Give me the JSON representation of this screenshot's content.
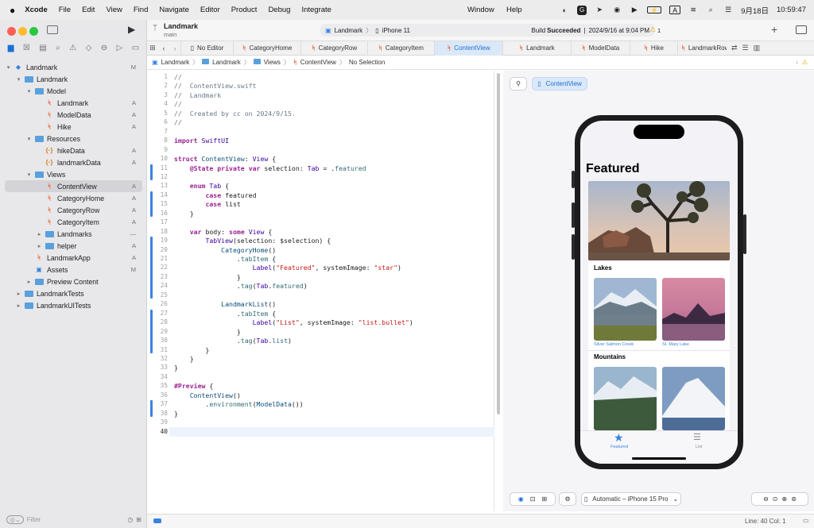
{
  "menubar": {
    "app": "Xcode",
    "items": [
      "File",
      "Edit",
      "View",
      "Find",
      "Navigate",
      "Editor",
      "Product",
      "Debug",
      "Integrate"
    ],
    "right_items": [
      "Window",
      "Help"
    ],
    "date": "9月18日",
    "time": "10:59:47",
    "input_indicator": "A"
  },
  "sidebar": {
    "tree": [
      {
        "label": "Landmark",
        "indent": 0,
        "icon": "project-icon",
        "chev": "▾",
        "badge": "M"
      },
      {
        "label": "Landmark",
        "indent": 1,
        "icon": "folder-icon",
        "chev": "▾",
        "badge": ""
      },
      {
        "label": "Model",
        "indent": 2,
        "icon": "folder-icon",
        "chev": "▾",
        "badge": ""
      },
      {
        "label": "Landmark",
        "indent": 3,
        "icon": "swift-icon",
        "chev": "",
        "badge": "A"
      },
      {
        "label": "ModelData",
        "indent": 3,
        "icon": "swift-icon",
        "chev": "",
        "badge": "A"
      },
      {
        "label": "Hike",
        "indent": 3,
        "icon": "swift-icon",
        "chev": "",
        "badge": "A"
      },
      {
        "label": "Resources",
        "indent": 2,
        "icon": "folder-icon",
        "chev": "▾",
        "badge": ""
      },
      {
        "label": "hikeData",
        "indent": 3,
        "icon": "json-icon",
        "chev": "",
        "badge": "A"
      },
      {
        "label": "landmarkData",
        "indent": 3,
        "icon": "json-icon",
        "chev": "",
        "badge": "A"
      },
      {
        "label": "Views",
        "indent": 2,
        "icon": "folder-icon",
        "chev": "▾",
        "badge": ""
      },
      {
        "label": "ContentView",
        "indent": 3,
        "icon": "swift-icon",
        "chev": "",
        "badge": "A",
        "selected": true
      },
      {
        "label": "CategoryHome",
        "indent": 3,
        "icon": "swift-icon",
        "chev": "",
        "badge": "A"
      },
      {
        "label": "CategoryRow",
        "indent": 3,
        "icon": "swift-icon",
        "chev": "",
        "badge": "A"
      },
      {
        "label": "CategoryItem",
        "indent": 3,
        "icon": "swift-icon",
        "chev": "",
        "badge": "A"
      },
      {
        "label": "Landmarks",
        "indent": 3,
        "icon": "folder-icon",
        "chev": "▸",
        "badge": "—"
      },
      {
        "label": "helper",
        "indent": 3,
        "icon": "folder-icon",
        "chev": "▸",
        "badge": "A"
      },
      {
        "label": "LandmarkApp",
        "indent": 2,
        "icon": "swift-icon",
        "chev": "",
        "badge": "A"
      },
      {
        "label": "Assets",
        "indent": 2,
        "icon": "assets-icon",
        "chev": "",
        "badge": "M"
      },
      {
        "label": "Preview Content",
        "indent": 2,
        "icon": "folder-icon",
        "chev": "▸",
        "badge": ""
      },
      {
        "label": "LandmarkTests",
        "indent": 1,
        "icon": "folder-icon",
        "chev": "▸",
        "badge": ""
      },
      {
        "label": "LandmarkUITests",
        "indent": 1,
        "icon": "folder-icon",
        "chev": "▸",
        "badge": ""
      }
    ],
    "filter_placeholder": "Filter"
  },
  "toolbar": {
    "project": "Landmark",
    "branch": "main",
    "scheme": "Landmark",
    "destination": "iPhone 11",
    "build_status_prefix": "Build",
    "build_status": "Succeeded",
    "build_date": "2024/9/16 at 9:04 PM",
    "warning_count": "1"
  },
  "tabs": [
    "No Editor",
    "CategoryHome",
    "CategoryRow",
    "CategoryItem",
    "ContentView",
    "Landmark",
    "ModelData",
    "Hike",
    "LandmarkRow"
  ],
  "active_tab": 4,
  "jumpbar": [
    "Landmark",
    "Landmark",
    "Views",
    "ContentView",
    "No Selection"
  ],
  "code": {
    "line_numbers": [
      "1",
      "2",
      "3",
      "4",
      "5",
      "6",
      "7",
      "8",
      "9",
      "10",
      "11",
      "12",
      "13",
      "14",
      "15",
      "16",
      "17",
      "18",
      "19",
      "20",
      "21",
      "22",
      "23",
      "24",
      "25",
      "26",
      "27",
      "28",
      "29",
      "30",
      "31",
      "32",
      "33",
      "34",
      "35",
      "36",
      "37",
      "38",
      "39",
      "40"
    ],
    "lines": [
      "//",
      "//  ContentView.swift",
      "//  Landmark",
      "//",
      "//  Created by cc on 2024/9/15.",
      "//",
      "",
      "import SwiftUI",
      "",
      "struct ContentView: View {",
      "    @State private var selection: Tab = .featured",
      "",
      "    enum Tab {",
      "        case featured",
      "        case list",
      "    }",
      "",
      "    var body: some View {",
      "        TabView(selection: $selection) {",
      "            CategoryHome()",
      "                .tabItem {",
      "                    Label(\"Featured\", systemImage: \"star\")",
      "                }",
      "                .tag(Tab.featured)",
      "",
      "            LandmarkList()",
      "                .tabItem {",
      "                    Label(\"List\", systemImage: \"list.bullet\")",
      "                }",
      "                .tag(Tab.list)",
      "        }",
      "    }",
      "}",
      "",
      "#Preview {",
      "    ContentView()",
      "        .environment(ModelData())",
      "}",
      "",
      ""
    ]
  },
  "canvas": {
    "preview_tag": "ContentView",
    "device_label": "Automatic – iPhone 15 Pro"
  },
  "phone": {
    "title": "Featured",
    "sections": [
      {
        "name": "Lakes",
        "items": [
          "Silver Salmon Creek",
          "St. Mary Lake"
        ]
      },
      {
        "name": "Mountains",
        "items": [
          "",
          ""
        ]
      }
    ],
    "tabbar": [
      "Featured",
      "List"
    ]
  },
  "status": {
    "cursor": "Line: 40  Col: 1"
  },
  "colors": {
    "accent": "#3b82e0",
    "selection": "#d4d4d8"
  }
}
